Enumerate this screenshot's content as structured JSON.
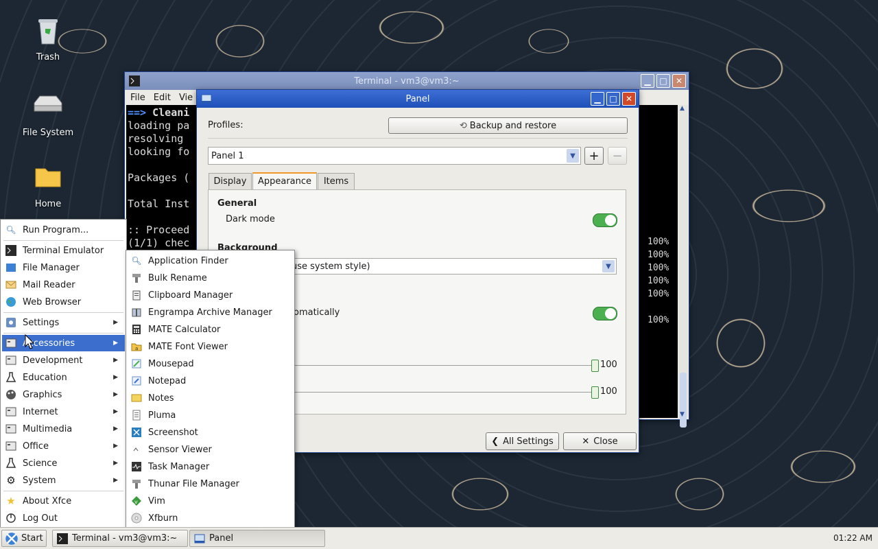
{
  "desktop": {
    "icons": [
      {
        "label": "Trash"
      },
      {
        "label": "File System"
      },
      {
        "label": "Home"
      }
    ]
  },
  "terminal": {
    "title": "Terminal - vm3@vm3:~",
    "menu": [
      "File",
      "Edit",
      "Vie"
    ],
    "lines": [
      "==> Cleani",
      "loading pa",
      "resolving",
      "looking fo",
      "",
      "Packages (",
      "",
      "Total Inst",
      "",
      ":: Proceed",
      "(1/1) chec"
    ],
    "percents": [
      "100%",
      "100%",
      "100%",
      "100%",
      "100%",
      "100%"
    ]
  },
  "panel_dialog": {
    "title": "Panel",
    "profiles_label": "Profiles:",
    "backup_button": "Backup and restore",
    "panel_select": "Panel 1",
    "tabs": [
      "Display",
      "Appearance",
      "Items"
    ],
    "active_tab": "Appearance",
    "general_heading": "General",
    "dark_mode_label": "Dark mode",
    "dark_mode_on": true,
    "background_heading": "Background",
    "style_select": "use system style)",
    "auto_label": "omatically",
    "auto_on": true,
    "slider1_value": "100",
    "slider2_value": "100",
    "all_settings_button": "All Settings",
    "close_button": "Close"
  },
  "start_menu": {
    "items": [
      {
        "label": "Run Program...",
        "icon": "search-icon"
      },
      {
        "label": "Terminal Emulator",
        "icon": "terminal-icon"
      },
      {
        "label": "File Manager",
        "icon": "file-manager-icon"
      },
      {
        "label": "Mail Reader",
        "icon": "mail-icon"
      },
      {
        "label": "Web Browser",
        "icon": "globe-icon"
      },
      {
        "label": "Settings",
        "icon": "settings-icon",
        "submenu": true
      },
      {
        "label": "Accessories",
        "icon": "accessories-icon",
        "submenu": true,
        "highlighted": true
      },
      {
        "label": "Development",
        "icon": "development-icon",
        "submenu": true
      },
      {
        "label": "Education",
        "icon": "flask-icon",
        "submenu": true
      },
      {
        "label": "Graphics",
        "icon": "palette-icon",
        "submenu": true
      },
      {
        "label": "Internet",
        "icon": "internet-icon",
        "submenu": true
      },
      {
        "label": "Multimedia",
        "icon": "multimedia-icon",
        "submenu": true
      },
      {
        "label": "Office",
        "icon": "office-icon",
        "submenu": true
      },
      {
        "label": "Science",
        "icon": "flask-icon",
        "submenu": true
      },
      {
        "label": "System",
        "icon": "gear-icon",
        "submenu": true
      },
      {
        "label": "About Xfce",
        "icon": "star-icon"
      },
      {
        "label": "Log Out",
        "icon": "logout-icon"
      }
    ]
  },
  "accessories_menu": {
    "items": [
      {
        "label": "Application Finder",
        "icon": "search-icon"
      },
      {
        "label": "Bulk Rename",
        "icon": "rename-icon"
      },
      {
        "label": "Clipboard Manager",
        "icon": "clipboard-icon"
      },
      {
        "label": "Engrampa Archive Manager",
        "icon": "archive-icon"
      },
      {
        "label": "MATE Calculator",
        "icon": "calculator-icon"
      },
      {
        "label": "MATE Font Viewer",
        "icon": "font-icon"
      },
      {
        "label": "Mousepad",
        "icon": "mousepad-icon"
      },
      {
        "label": "Notepad",
        "icon": "notepad-icon"
      },
      {
        "label": "Notes",
        "icon": "notes-icon"
      },
      {
        "label": "Pluma",
        "icon": "pluma-icon"
      },
      {
        "label": "Screenshot",
        "icon": "screenshot-icon"
      },
      {
        "label": "Sensor Viewer",
        "icon": "sensor-icon"
      },
      {
        "label": "Task Manager",
        "icon": "task-manager-icon"
      },
      {
        "label": "Thunar File Manager",
        "icon": "thunar-icon"
      },
      {
        "label": "Vim",
        "icon": "vim-icon"
      },
      {
        "label": "Xfburn",
        "icon": "disc-icon"
      }
    ]
  },
  "taskbar": {
    "start_label": "Start",
    "tasks": [
      "Terminal - vm3@vm3:~",
      "Panel"
    ],
    "clock": "01:22 AM"
  }
}
